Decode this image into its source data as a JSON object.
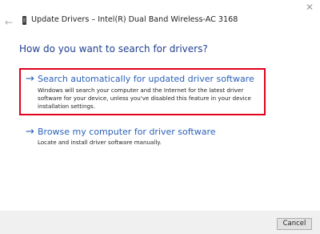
{
  "window": {
    "title": "Update Drivers – Intel(R) Dual Band Wireless-AC 3168",
    "close_glyph": "✕",
    "back_glyph": "←"
  },
  "main": {
    "heading": "How do you want to search for drivers?",
    "options": [
      {
        "arrow": "→",
        "title": "Search automatically for updated driver software",
        "description": "Windows will search your computer and the Internet for the latest driver software for your device, unless you've disabled this feature in your device installation settings.",
        "highlighted": true,
        "highlight_color": "#e0001b"
      },
      {
        "arrow": "→",
        "title": "Browse my computer for driver software",
        "description": "Locate and install driver software manually."
      }
    ]
  },
  "footer": {
    "cancel_label": "Cancel"
  },
  "colors": {
    "accent": "#2b61b8",
    "heading": "#1f3f8f",
    "footer_bg": "#f0f0f0"
  }
}
